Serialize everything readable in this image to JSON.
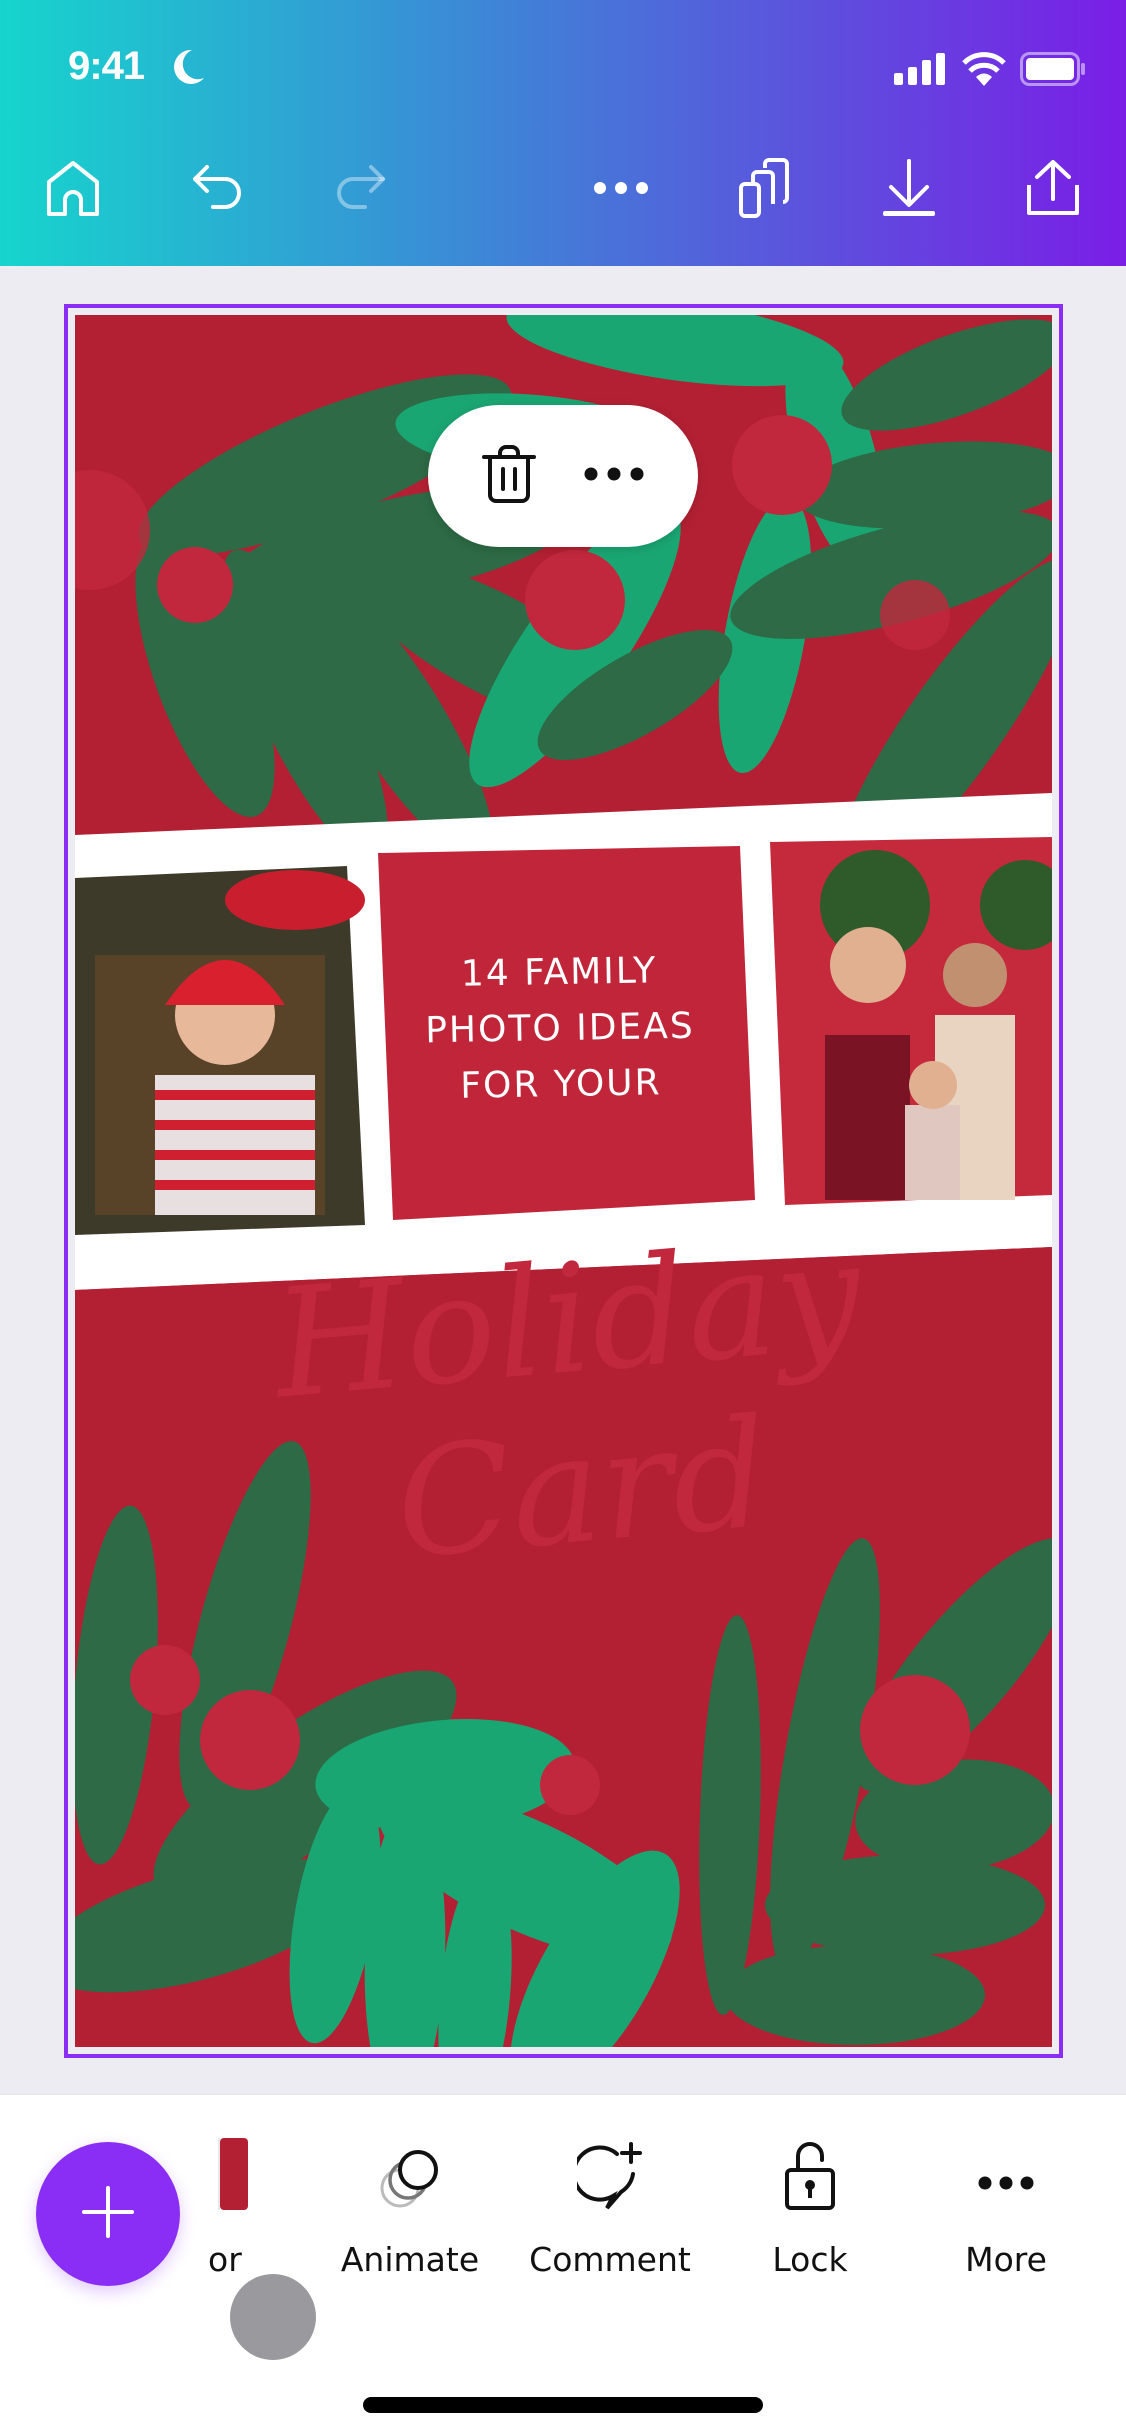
{
  "status_bar": {
    "time": "9:41",
    "icons": [
      "moon-icon",
      "cellular-signal-icon",
      "wifi-icon",
      "battery-icon"
    ]
  },
  "top_toolbar": {
    "buttons": [
      {
        "name": "home",
        "icon": "home-icon"
      },
      {
        "name": "undo",
        "icon": "undo-icon"
      },
      {
        "name": "redo",
        "icon": "redo-icon",
        "disabled": true
      },
      {
        "name": "more-options",
        "icon": "ellipsis-icon"
      },
      {
        "name": "pages",
        "icon": "pages-icon"
      },
      {
        "name": "download",
        "icon": "download-icon"
      },
      {
        "name": "share",
        "icon": "share-icon"
      }
    ]
  },
  "context_menu": {
    "items": [
      {
        "name": "delete",
        "icon": "trash-icon"
      },
      {
        "name": "more",
        "icon": "ellipsis-icon"
      }
    ]
  },
  "design": {
    "headline_lines": [
      "14 FAMILY",
      "PHOTO IDEAS",
      "FOR YOUR"
    ],
    "script_lines": [
      "Holiday",
      "Card"
    ],
    "photos": [
      {
        "name": "baby-santa-hat-photo",
        "description": "baby in santa hat and striped pajamas held by father near christmas tree"
      },
      {
        "name": "family-door-photo",
        "description": "family of three in front of red doors with wreaths"
      }
    ],
    "colors": {
      "background": "#b32033",
      "dark_green": "#2d6a45",
      "light_green": "#1aa673",
      "berry": "#c2283d",
      "selection": "#8b2ef5"
    }
  },
  "bottom_toolbar": {
    "add_button_icon": "plus-icon",
    "tools": [
      {
        "label": "or",
        "icon": "color-swatch-icon"
      },
      {
        "label": "Animate",
        "icon": "animate-icon"
      },
      {
        "label": "Comment",
        "icon": "comment-add-icon"
      },
      {
        "label": "Lock",
        "icon": "unlock-icon"
      },
      {
        "label": "More",
        "icon": "ellipsis-icon"
      }
    ]
  }
}
